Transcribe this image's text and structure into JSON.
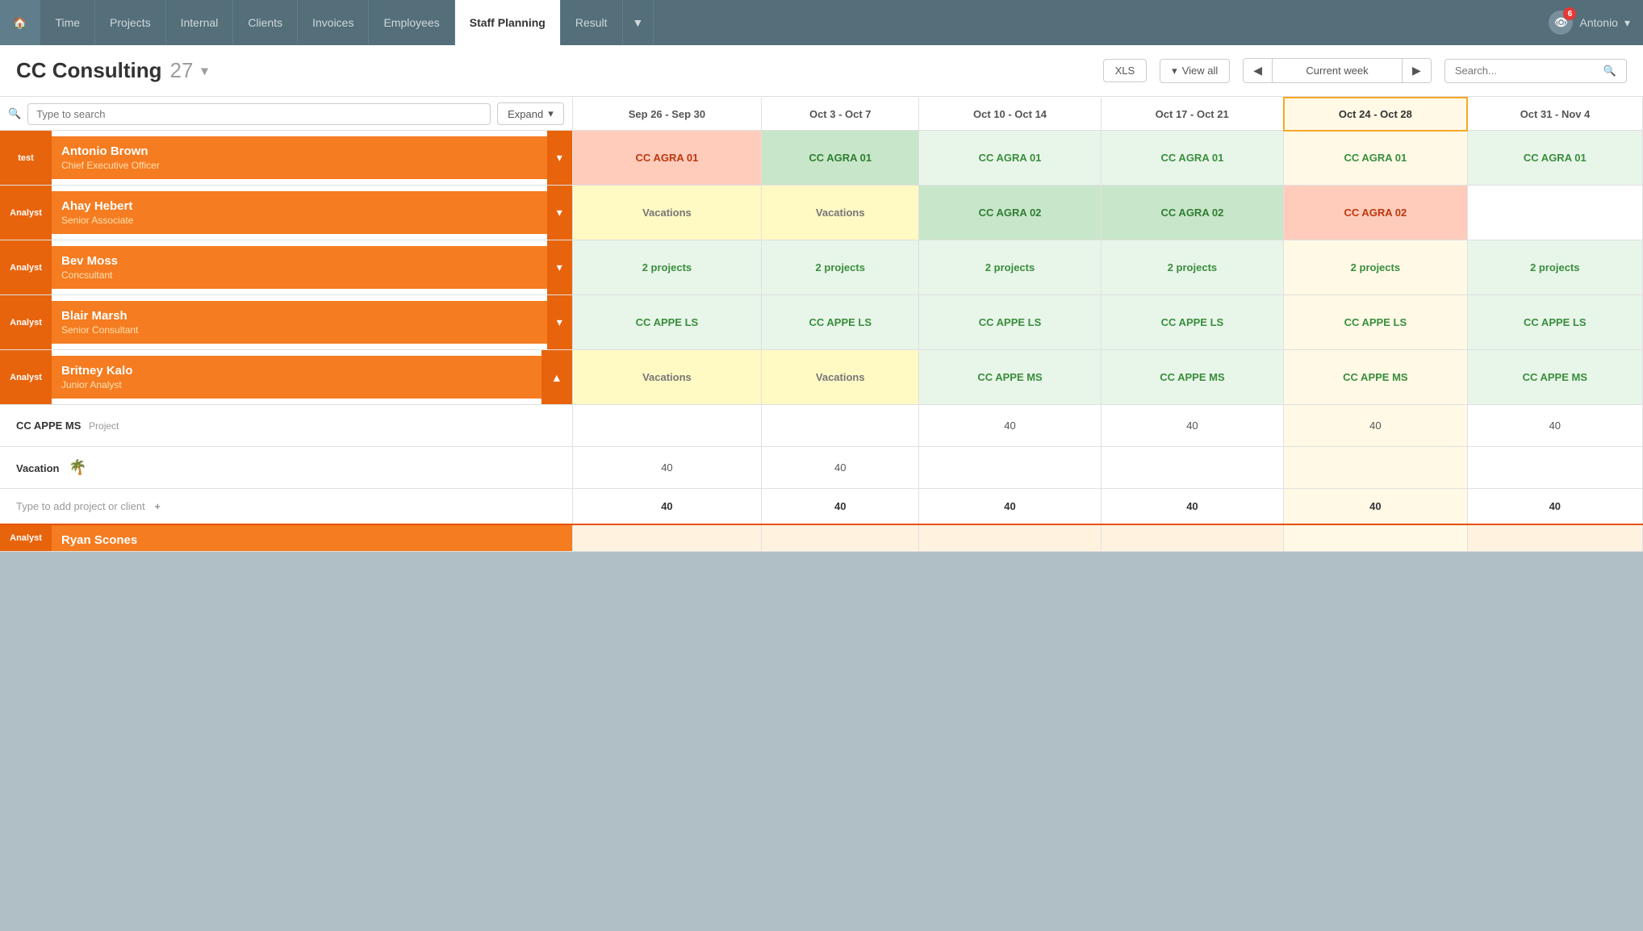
{
  "nav": {
    "items": [
      {
        "label": "🏠",
        "id": "home",
        "active": false
      },
      {
        "label": "Time",
        "id": "time",
        "active": false
      },
      {
        "label": "Projects",
        "id": "projects",
        "active": false
      },
      {
        "label": "Internal",
        "id": "internal",
        "active": false
      },
      {
        "label": "Clients",
        "id": "clients",
        "active": false
      },
      {
        "label": "Invoices",
        "id": "invoices",
        "active": false
      },
      {
        "label": "Employees",
        "id": "employees",
        "active": false
      },
      {
        "label": "Staff Planning",
        "id": "staff-planning",
        "active": true
      },
      {
        "label": "Result",
        "id": "result",
        "active": false
      }
    ],
    "more_label": "▼",
    "user_name": "Antonio",
    "badge_count": "6"
  },
  "header": {
    "company_name": "CC Consulting",
    "employee_count": "27",
    "xls_label": "XLS",
    "view_all_label": "View all",
    "current_week_label": "Current week",
    "search_placeholder": "Search..."
  },
  "table": {
    "search_placeholder": "Type to search",
    "expand_label": "Expand",
    "columns": [
      {
        "label": "Sep 26 - Sep 30",
        "id": "col1",
        "current": false
      },
      {
        "label": "Oct 3 - Oct 7",
        "id": "col2",
        "current": false
      },
      {
        "label": "Oct 10 - Oct 14",
        "id": "col3",
        "current": false
      },
      {
        "label": "Oct 17 - Oct 21",
        "id": "col4",
        "current": false
      },
      {
        "label": "Oct 24 - Oct 28",
        "id": "col5",
        "current": true
      },
      {
        "label": "Oct 31 - Nov 4",
        "id": "col6",
        "current": false
      }
    ],
    "employees": [
      {
        "id": "antonio",
        "role": "test",
        "name": "Antonio Brown",
        "title": "Chief Executive Officer",
        "expanded": false,
        "cells": [
          "CC AGRA 01",
          "CC AGRA 01",
          "CC AGRA 01",
          "CC AGRA 01",
          "CC AGRA 01",
          "CC AGRA 01"
        ],
        "cell_types": [
          "salmon",
          "green",
          "light-green",
          "light-green",
          "light-green",
          "light-green"
        ]
      },
      {
        "id": "ahay",
        "role": "Analyst",
        "name": "Ahay Hebert",
        "title": "Senior Associate",
        "expanded": false,
        "cells": [
          "Vacations",
          "Vacations",
          "CC AGRA 02",
          "CC AGRA 02",
          "CC AGRA 02",
          ""
        ],
        "cell_types": [
          "vacation",
          "vacation",
          "green",
          "green",
          "salmon",
          "white"
        ]
      },
      {
        "id": "bev",
        "role": "Analyst",
        "name": "Bev Moss",
        "title": "Concsultant",
        "expanded": false,
        "cells": [
          "2 projects",
          "2 projects",
          "2 projects",
          "2 projects",
          "2 projects",
          "2 projects"
        ],
        "cell_types": [
          "light-green",
          "light-green",
          "light-green",
          "light-green",
          "light-green",
          "light-green"
        ]
      },
      {
        "id": "blair",
        "role": "Analyst",
        "name": "Blair Marsh",
        "title": "Senior Consultant",
        "expanded": false,
        "cells": [
          "CC APPE LS",
          "CC APPE LS",
          "CC APPE LS",
          "CC APPE LS",
          "CC APPE LS",
          "CC APPE LS"
        ],
        "cell_types": [
          "light-green",
          "light-green",
          "light-green",
          "light-green",
          "light-green",
          "light-green"
        ]
      },
      {
        "id": "britney",
        "role": "Analyst",
        "name": "Britney Kalo",
        "title": "Junior Analyst",
        "expanded": true,
        "cells": [
          "Vacations",
          "Vacations",
          "CC APPE MS",
          "CC APPE MS",
          "CC APPE MS",
          "CC APPE MS"
        ],
        "cell_types": [
          "vacation",
          "vacation",
          "light-green",
          "light-green",
          "light-green",
          "light-green"
        ]
      }
    ],
    "sub_rows": [
      {
        "label": "CC APPE MS",
        "tag": "Project",
        "cells": [
          "",
          "",
          "40",
          "40",
          "40",
          "40"
        ]
      },
      {
        "label": "Vacation",
        "icon": "🌴",
        "cells": [
          "40",
          "40",
          "",
          "",
          "",
          ""
        ]
      }
    ],
    "add_row": {
      "label": "Type to add project or client",
      "cells": [
        "40",
        "40",
        "40",
        "40",
        "40",
        "40"
      ]
    },
    "partial_row": {
      "role": "Analyst",
      "name": "Ryan Scones"
    }
  }
}
